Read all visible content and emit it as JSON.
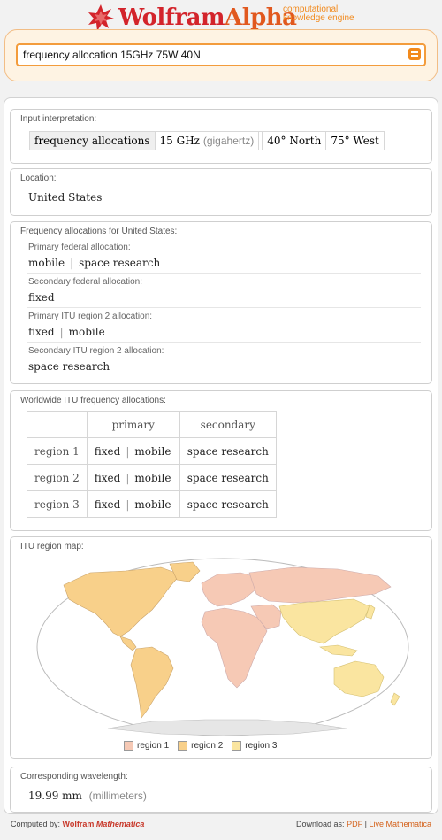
{
  "header": {
    "logo_wordmark_1": "Wolfram",
    "logo_wordmark_2": "Alpha",
    "tagline_line1": "computational",
    "tagline_line2": "knowledge engine",
    "logo_icon": "wolfram-star-icon"
  },
  "search": {
    "query": "frequency allocation 15GHz 75W 40N",
    "submit_icon": "equals-icon"
  },
  "pods": {
    "input": {
      "title": "Input interpretation:",
      "term": "frequency allocations",
      "freq_value": "15 GHz",
      "freq_unit": "(gigahertz)",
      "lat_value": "40°",
      "lat_dir": "North",
      "lon_value": "75°",
      "lon_dir": "West"
    },
    "location": {
      "title": "Location:",
      "value": "United States"
    },
    "us_alloc": {
      "title": "Frequency allocations for United States:",
      "primary_federal_label": "Primary federal allocation:",
      "primary_federal_a": "mobile",
      "primary_federal_b": "space research",
      "secondary_federal_label": "Secondary federal allocation:",
      "secondary_federal": "fixed",
      "primary_itu2_label": "Primary ITU region 2 allocation:",
      "primary_itu2_a": "fixed",
      "primary_itu2_b": "mobile",
      "secondary_itu2_label": "Secondary ITU region 2 allocation:",
      "secondary_itu2": "space research",
      "separator": "|"
    },
    "worldwide": {
      "title": "Worldwide ITU frequency allocations:",
      "col_primary": "primary",
      "col_secondary": "secondary",
      "rows": [
        {
          "region": "region 1",
          "p1": "fixed",
          "p2": "mobile",
          "secondary": "space research"
        },
        {
          "region": "region 2",
          "p1": "fixed",
          "p2": "mobile",
          "secondary": "space research"
        },
        {
          "region": "region 3",
          "p1": "fixed",
          "p2": "mobile",
          "secondary": "space research"
        }
      ]
    },
    "map": {
      "title": "ITU region map:",
      "legend": [
        {
          "label": "region 1",
          "color": "#f6c9b5"
        },
        {
          "label": "region 2",
          "color": "#f8d08a"
        },
        {
          "label": "region 3",
          "color": "#fae5a0"
        }
      ]
    },
    "wavelength": {
      "title": "Corresponding wavelength:",
      "value": "19.99 mm",
      "unit": "(millimeters)"
    }
  },
  "footer": {
    "computed_by": "Computed by:",
    "brand_1": "Wolfram",
    "brand_2": "Mathematica",
    "download_as": "Download as:",
    "pdf": "PDF",
    "sep": "|",
    "live": "Live Mathematica"
  },
  "colors": {
    "brand_red": "#d3242b",
    "accent_orange": "#f28a1d"
  }
}
